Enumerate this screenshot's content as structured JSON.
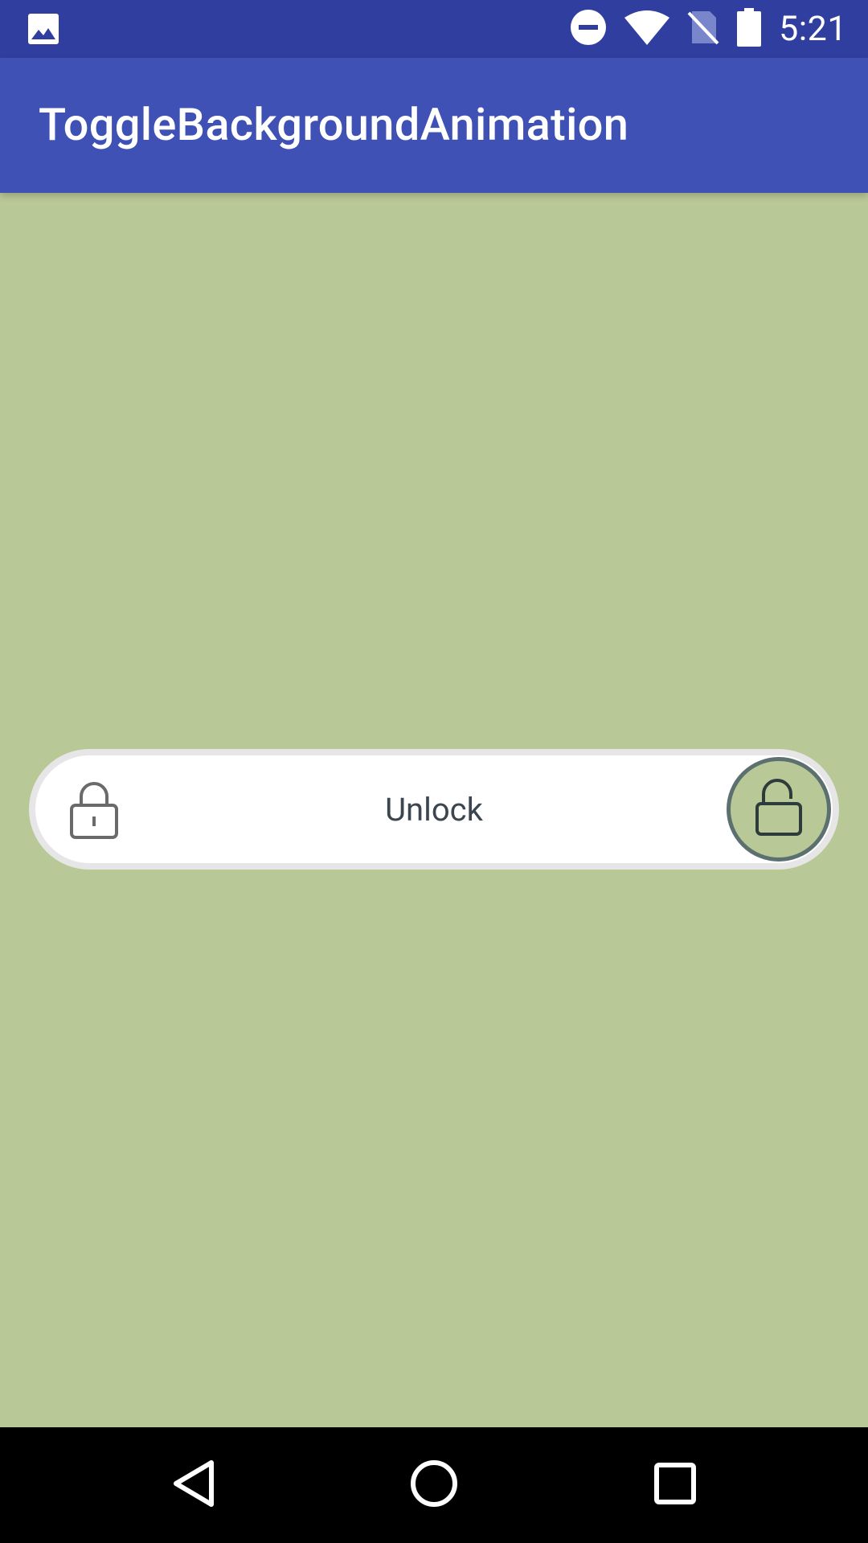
{
  "status_bar": {
    "time": "5:21",
    "icons": [
      "image-icon",
      "do-not-disturb-icon",
      "wifi-icon",
      "no-sim-icon",
      "battery-icon"
    ]
  },
  "toolbar": {
    "title": "ToggleBackgroundAnimation",
    "color": "#3F51B5"
  },
  "toggle": {
    "label": "Unlock",
    "left_icon": "lock-icon",
    "knob_icon": "unlock-icon",
    "state": "unlocked",
    "background_color": "#B8C897"
  },
  "nav_bar": {
    "buttons": [
      "back-button",
      "home-button",
      "recents-button"
    ]
  }
}
